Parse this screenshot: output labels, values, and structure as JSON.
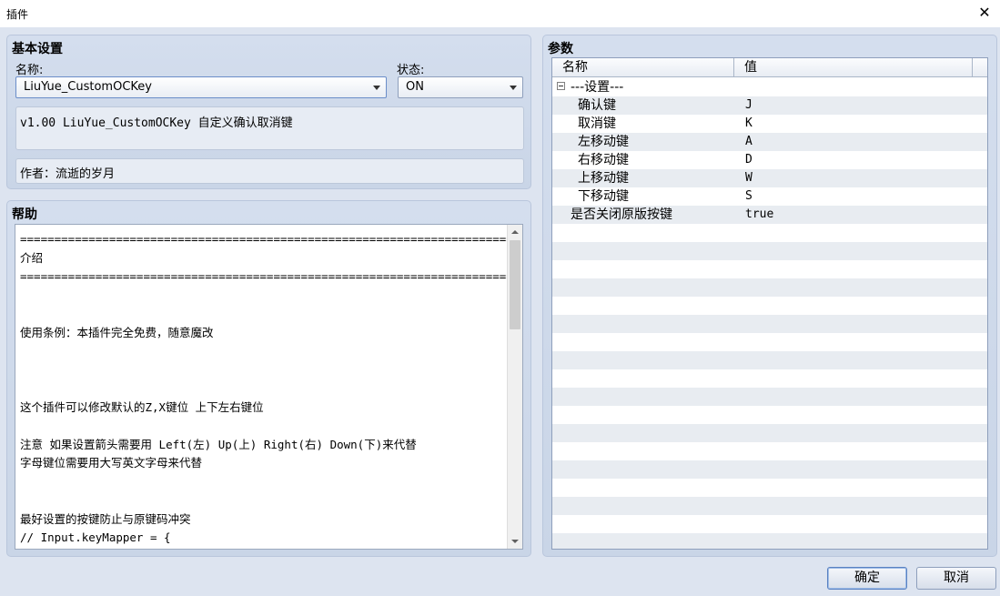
{
  "window": {
    "title": "插件",
    "close_glyph": "✕"
  },
  "basic": {
    "title": "基本设置",
    "name_label": "名称:",
    "name_value": "LiuYue_CustomOCKey",
    "status_label": "状态:",
    "status_value": "ON",
    "description": "v1.00 LiuYue_CustomOCKey 自定义确认取消键",
    "author": "作者：流逝的岁月"
  },
  "help": {
    "title": "帮助",
    "lines": [
      "===========================================================================",
      "介绍",
      "===========================================================================",
      "",
      "",
      "使用条例：本插件完全免费，随意魔改",
      "",
      "",
      "",
      "这个插件可以修改默认的Z,X键位 上下左右键位",
      "",
      "注意 如果设置箭头需要用 Left(左) Up(上) Right(右) Down(下)来代替",
      "字母键位需要用大写英文字母来代替",
      "",
      "",
      "最好设置的按键防止与原键码冲突",
      "// Input.keyMapper = {"
    ]
  },
  "params": {
    "title": "参数",
    "col_name": "名称",
    "col_value": "值",
    "rows": [
      {
        "name": "---设置---",
        "value": "",
        "group": true
      },
      {
        "name": "确认键",
        "value": "J"
      },
      {
        "name": "取消键",
        "value": "K"
      },
      {
        "name": "左移动键",
        "value": "A"
      },
      {
        "name": "右移动键",
        "value": "D"
      },
      {
        "name": "上移动键",
        "value": "W"
      },
      {
        "name": "下移动键",
        "value": "S"
      },
      {
        "name": "是否关闭原版按键",
        "value": "true",
        "top": true
      },
      {},
      {},
      {},
      {},
      {},
      {},
      {},
      {},
      {},
      {},
      {},
      {},
      {},
      {},
      {},
      {},
      {},
      {}
    ]
  },
  "buttons": {
    "ok": "确定",
    "cancel": "取消"
  }
}
